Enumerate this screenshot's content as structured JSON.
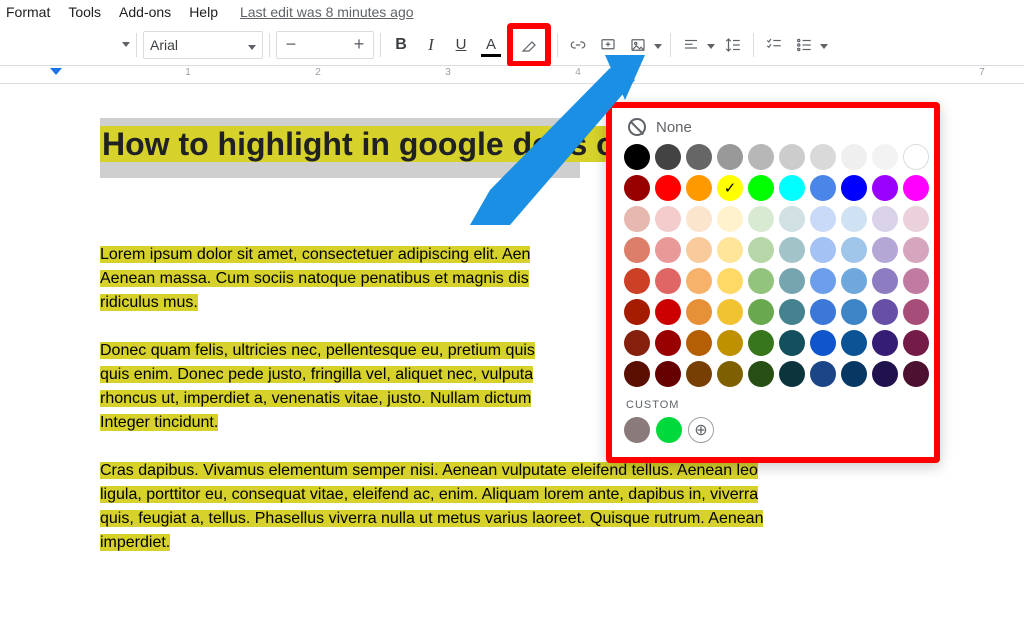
{
  "menubar": {
    "format": "Format",
    "tools": "Tools",
    "addons": "Add-ons",
    "help": "Help",
    "last_edit": "Last edit was 8 minutes ago"
  },
  "toolbar": {
    "font_name": "Arial",
    "zoom_display": ""
  },
  "ruler_labels": [
    "1",
    "2",
    "3",
    "4",
    "7"
  ],
  "document": {
    "heading": "How to highlight in google docs o",
    "p1a": "Lorem ipsum dolor sit amet, consectetuer adipiscing elit. Aen",
    "p1b": "Aenean massa. Cum sociis natoque penatibus et magnis dis",
    "p1c": "ridiculus mus.",
    "p2a": "Donec quam felis, ultricies nec, pellentesque eu, pretium quis",
    "p2b": "quis enim. Donec pede justo, fringilla vel, aliquet nec, vulputa",
    "p2c": "rhoncus ut, imperdiet a, venenatis vitae, justo. Nullam dictum",
    "p2d": "Integer tincidunt.",
    "p3a": "Cras dapibus. Vivamus elementum semper nisi. Aenean vulputate eleifend tellus. Aenean leo",
    "p3b": "ligula, porttitor eu, consequat vitae, eleifend ac, enim. Aliquam lorem ante, dapibus in, viverra",
    "p3c": "quis, feugiat a, tellus. Phasellus viverra nulla ut metus varius laoreet. Quisque rutrum. Aenean",
    "p3d": "imperdiet."
  },
  "picker": {
    "none_label": "None",
    "custom_label": "CUSTOM",
    "selected_index": 13,
    "palette": [
      "#000000",
      "#434343",
      "#666666",
      "#999999",
      "#b7b7b7",
      "#cccccc",
      "#d9d9d9",
      "#efefef",
      "#f3f3f3",
      "#ffffff",
      "#980000",
      "#ff0000",
      "#ff9900",
      "#ffff00",
      "#00ff00",
      "#00ffff",
      "#4a86e8",
      "#0000ff",
      "#9900ff",
      "#ff00ff",
      "#e6b8af",
      "#f4cccc",
      "#fce5cd",
      "#fff2cc",
      "#d9ead3",
      "#d0e0e3",
      "#c9daf8",
      "#cfe2f3",
      "#d9d2e9",
      "#ead1dc",
      "#dd7e6b",
      "#ea9999",
      "#f9cb9c",
      "#ffe599",
      "#b6d7a8",
      "#a2c4c9",
      "#a4c2f4",
      "#9fc5e8",
      "#b4a7d6",
      "#d5a6bd",
      "#cc4125",
      "#e06666",
      "#f6b26b",
      "#ffd966",
      "#93c47d",
      "#76a5af",
      "#6d9eeb",
      "#6fa8dc",
      "#8e7cc3",
      "#c27ba0",
      "#a61c00",
      "#cc0000",
      "#e69138",
      "#f1c232",
      "#6aa84f",
      "#45818e",
      "#3c78d8",
      "#3d85c6",
      "#674ea7",
      "#a64d79",
      "#85200c",
      "#990000",
      "#b45f06",
      "#bf9000",
      "#38761d",
      "#134f5c",
      "#1155cc",
      "#0b5394",
      "#351c75",
      "#741b47",
      "#5b0f00",
      "#660000",
      "#783f04",
      "#7f6000",
      "#274e13",
      "#0c343d",
      "#1c4587",
      "#073763",
      "#20124d",
      "#4c1130"
    ],
    "custom_swatches": [
      "#8a7a7a",
      "#00d93b"
    ]
  }
}
